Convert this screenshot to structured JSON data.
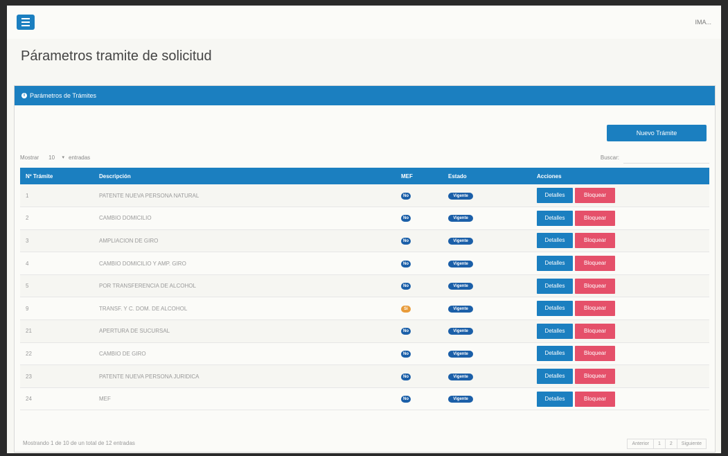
{
  "header": {
    "user": "IMA..."
  },
  "page_title": "Párametros tramite de solicitud",
  "panel": {
    "title": "Parámetros de Trámites",
    "new_button": "Nuevo Trámite",
    "length_label_before": "Mostrar",
    "length_value": "10",
    "length_label_after": "entradas",
    "search_label": "Buscar:",
    "columns": [
      "Nº Trámite",
      "Descripción",
      "MEF",
      "Estado",
      "Acciones"
    ],
    "rows": [
      {
        "num": "1",
        "desc": "PATENTE NUEVA PERSONA NATURAL",
        "mef": "No",
        "estado": "Vigente"
      },
      {
        "num": "2",
        "desc": "CAMBIO DOMICILIO",
        "mef": "No",
        "estado": "Vigente"
      },
      {
        "num": "3",
        "desc": "AMPLIACION DE GIRO",
        "mef": "No",
        "estado": "Vigente"
      },
      {
        "num": "4",
        "desc": "CAMBIO DOMICILIO Y AMP. GIRO",
        "mef": "No",
        "estado": "Vigente"
      },
      {
        "num": "5",
        "desc": "POR TRANSFERENCIA DE ALCOHOL",
        "mef": "No",
        "estado": "Vigente"
      },
      {
        "num": "9",
        "desc": "TRANSF. Y C. DOM. DE ALCOHOL",
        "mef": "Si",
        "estado": "Vigente"
      },
      {
        "num": "21",
        "desc": "APERTURA DE SUCURSAL",
        "mef": "No",
        "estado": "Vigente"
      },
      {
        "num": "22",
        "desc": "CAMBIO DE GIRO",
        "mef": "No",
        "estado": "Vigente"
      },
      {
        "num": "23",
        "desc": "PATENTE NUEVA PERSONA JURIDICA",
        "mef": "No",
        "estado": "Vigente"
      },
      {
        "num": "24",
        "desc": "MEF",
        "mef": "No",
        "estado": "Vigente"
      }
    ],
    "action_details": "Detalles",
    "action_block": "Bloquear",
    "footer_info": "Mostrando 1 de 10 de un total de 12 entradas",
    "pager": [
      "Anterior",
      "1",
      "2",
      "Siguiente"
    ]
  },
  "colors": {
    "primary": "#1b7fc0",
    "danger": "#e5506a",
    "warning": "#e89b3a"
  }
}
